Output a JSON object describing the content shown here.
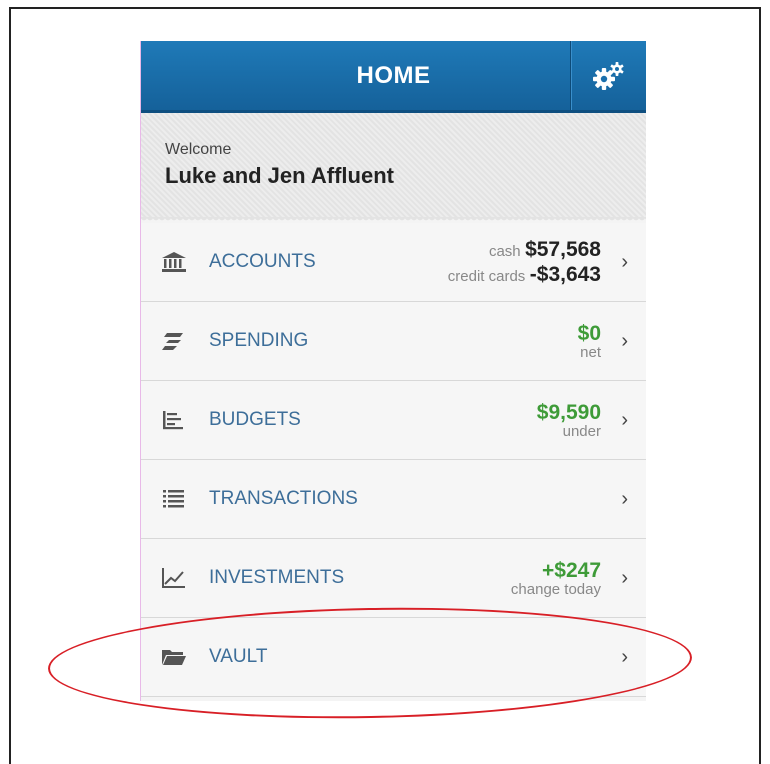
{
  "header": {
    "title": "HOME",
    "settings_icon": "gear-icon"
  },
  "welcome": {
    "greeting": "Welcome",
    "name": "Luke and Jen Affluent"
  },
  "menu": {
    "accounts": {
      "label": "ACCOUNTS",
      "icon": "bank-icon",
      "cash_label": "cash",
      "cash_value": "$57,568",
      "credit_label": "credit cards",
      "credit_value": "-$3,643"
    },
    "spending": {
      "label": "SPENDING",
      "icon": "spending-icon",
      "value": "$0",
      "sub": "net"
    },
    "budgets": {
      "label": "BUDGETS",
      "icon": "budgets-icon",
      "value": "$9,590",
      "sub": "under"
    },
    "transactions": {
      "label": "TRANSACTIONS",
      "icon": "list-icon"
    },
    "investments": {
      "label": "INVESTMENTS",
      "icon": "chart-icon",
      "value": "+$247",
      "sub": "change today"
    },
    "vault": {
      "label": "VAULT",
      "icon": "folder-icon"
    }
  },
  "chevron": "›",
  "colors": {
    "header": "#1a6fac",
    "link": "#3d6e99",
    "positive": "#3e9b38",
    "annotation": "#d81f26"
  }
}
